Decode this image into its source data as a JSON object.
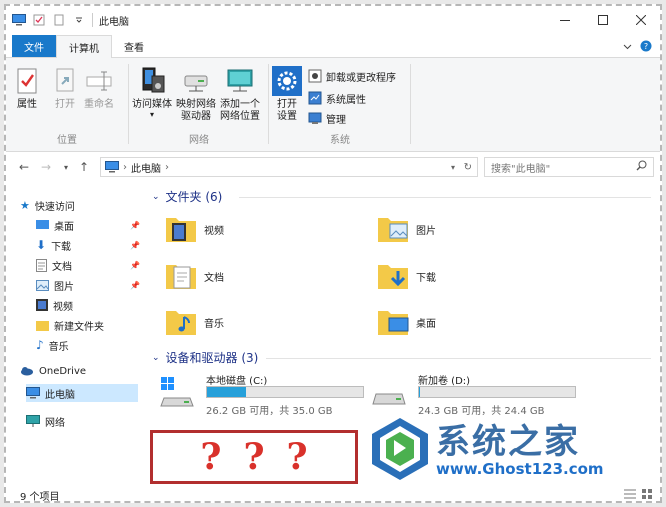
{
  "window": {
    "title": "此电脑"
  },
  "tabs": {
    "file": "文件",
    "computer": "计算机",
    "view": "查看"
  },
  "ribbon": {
    "location": {
      "label": "位置",
      "properties": "属性",
      "open": "打开",
      "rename": "重命名"
    },
    "network": {
      "label": "网络",
      "media": "访问媒体",
      "map_drive": "映射网络\n驱动器",
      "add_location": "添加一个\n网络位置"
    },
    "system": {
      "label": "系统",
      "open_settings": "打开\n设置",
      "uninstall": "卸载或更改程序",
      "sys_props": "系统属性",
      "manage": "管理"
    }
  },
  "address": {
    "path": "此电脑"
  },
  "search": {
    "placeholder": "搜索\"此电脑\""
  },
  "nav": {
    "quick_access": "快速访问",
    "items": [
      {
        "label": "桌面",
        "pinned": true
      },
      {
        "label": "下载",
        "pinned": true
      },
      {
        "label": "文档",
        "pinned": true
      },
      {
        "label": "图片",
        "pinned": true
      },
      {
        "label": "视频",
        "pinned": false
      },
      {
        "label": "新建文件夹",
        "pinned": false
      },
      {
        "label": "音乐",
        "pinned": false
      }
    ],
    "onedrive": "OneDrive",
    "this_pc": "此电脑",
    "network": "网络"
  },
  "folders": {
    "header": "文件夹 (6)",
    "items": [
      "视频",
      "图片",
      "文档",
      "下载",
      "音乐",
      "桌面"
    ]
  },
  "devices": {
    "header": "设备和驱动器 (3)",
    "drives": [
      {
        "name": "本地磁盘 (C:)",
        "info": "26.2 GB 可用，共 35.0 GB",
        "used_fraction": 0.25
      },
      {
        "name": "新加卷 (D:)",
        "info": "24.3 GB 可用，共 24.4 GB",
        "used_fraction": 0.004
      }
    ]
  },
  "status": {
    "count": "9 个项目"
  },
  "overlay": {
    "qmarks": [
      "?",
      "?",
      "?"
    ]
  },
  "watermark": {
    "title": "系统之家",
    "url": "www.Ghost123.com"
  },
  "colors": {
    "accent": "#1979ca",
    "folder": "#f3c948",
    "drive_fill": "#26a0da",
    "selection": "#cce8ff",
    "qbox": "#b22f2f"
  }
}
